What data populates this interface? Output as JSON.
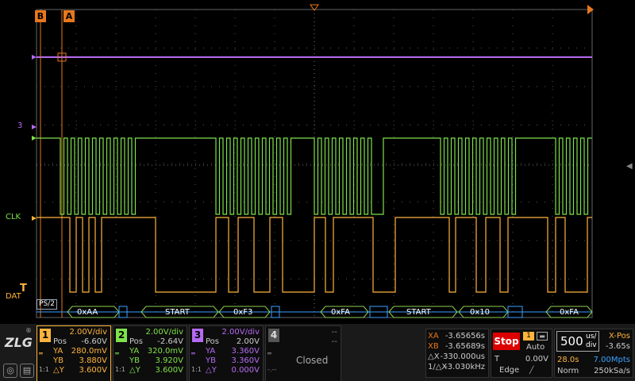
{
  "cursors": {
    "b": "B",
    "a": "A"
  },
  "channel_labels": {
    "ch3": "3",
    "clk": "CLK",
    "dat": "DAT",
    "trig_mark": "T"
  },
  "decode": {
    "protocol": "PS/2",
    "packets": [
      "0xAA",
      "START",
      "0xF3",
      "0xFA",
      "START",
      "0x10",
      "0xFA"
    ],
    "colors": {
      "packet": "#8fd14f",
      "frame": "#3aa0ff",
      "ack": "#c85cff"
    }
  },
  "colors": {
    "ch1": "#ffb43c",
    "ch2": "#7ee24a",
    "ch3": "#b56bf2",
    "grid": "#555555",
    "cursor": "#e8771d"
  },
  "ch1": {
    "num": "1",
    "scale": "2.00V/div",
    "pos_label": "Pos",
    "pos": "-6.60V",
    "ya_label": "YA",
    "ya": "280.0mV",
    "yb_label": "YB",
    "yb": "3.880V",
    "dy_label": "△Y",
    "dy": "3.600V",
    "side_a": "1:1"
  },
  "ch2": {
    "num": "2",
    "scale": "2.00V/div",
    "pos_label": "Pos",
    "pos": "-2.64V",
    "ya_label": "YA",
    "ya": "320.0mV",
    "yb_label": "YB",
    "yb": "3.920V",
    "dy_label": "△Y",
    "dy": "3.600V",
    "side_a": "1:1"
  },
  "ch3": {
    "num": "3",
    "scale": "2.00V/div",
    "pos_label": "Pos",
    "pos": "2.00V",
    "ya_label": "YA",
    "ya": "3.360V",
    "yb_label": "YB",
    "yb": "3.360V",
    "dy_label": "△Y",
    "dy": "0.000V",
    "side_a": "1:1"
  },
  "ch4": {
    "num": "4",
    "line1": "--",
    "line2": "--",
    "status": "Closed",
    "dash": "-.--"
  },
  "cursor_meas": {
    "xa_label": "XA",
    "xa": "-3.65656s",
    "xb_label": "XB",
    "xb": "-3.65689s",
    "dx_label": "△X",
    "dx": "-330.000us",
    "inv_label": "1/△X",
    "inv": "-3.030kHz"
  },
  "trigger": {
    "state": "Stop",
    "mode": "Auto",
    "source": "1",
    "t_label": "T",
    "level": "0.00V",
    "type": "Edge"
  },
  "timebase": {
    "value": "500",
    "unit_top": "us/",
    "unit_bot": "div",
    "xpos_label": "X-Pos",
    "xpos": "-3.65s",
    "record_time": "28.0s",
    "mpts": "7.00Mpts",
    "acq": "Norm",
    "rate": "250kSa/s"
  }
}
